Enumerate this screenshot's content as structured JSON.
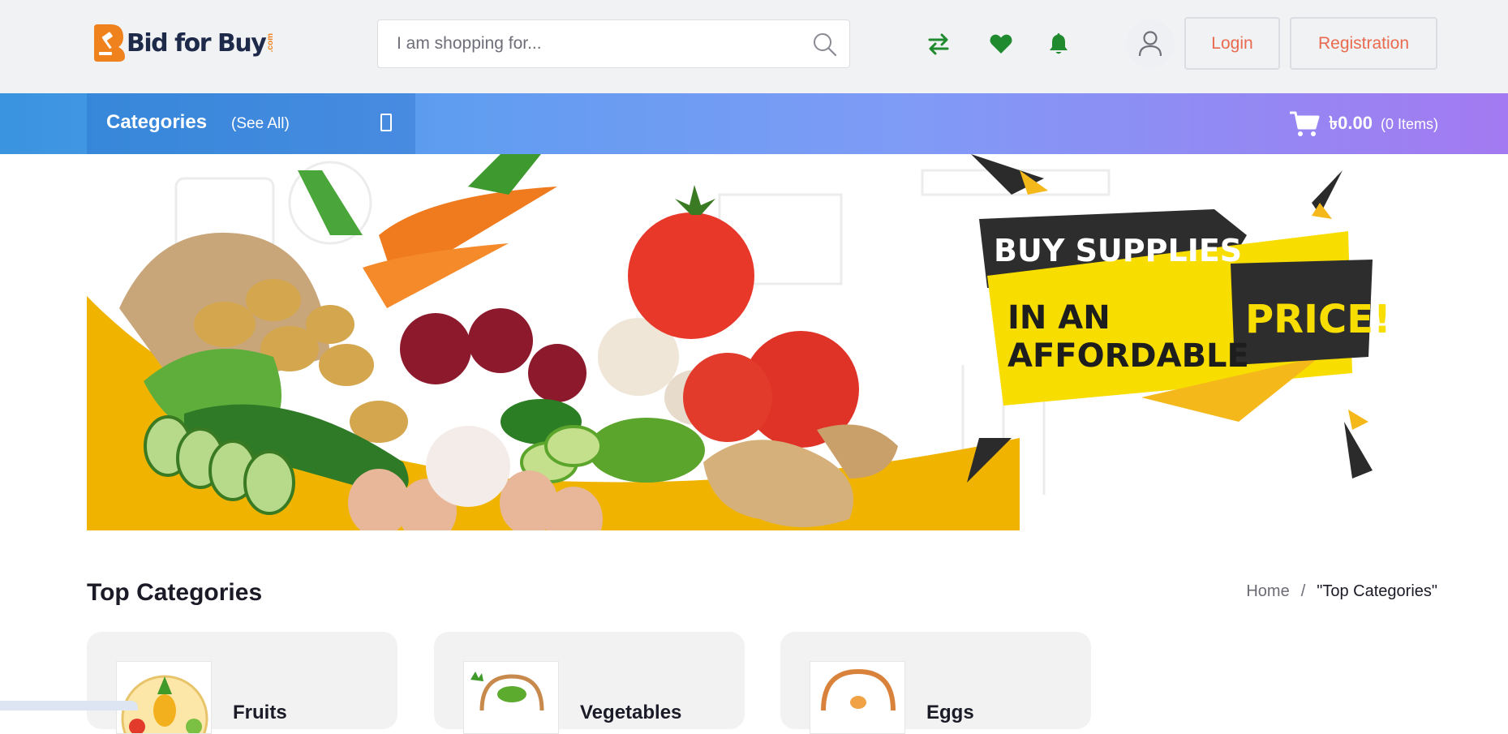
{
  "header": {
    "logo_text": "Bid for Buy",
    "logo_suffix": ".com",
    "search": {
      "placeholder": "I am shopping for..."
    },
    "icons": {
      "compare": "compare-arrows-icon",
      "wishlist": "heart-icon",
      "notifications": "bell-icon",
      "account": "user-icon"
    },
    "login_label": "Login",
    "registration_label": "Registration"
  },
  "nav": {
    "categories_label": "Categories",
    "see_all_label": "(See All)",
    "cart": {
      "amount": "৳0.00",
      "items": "(0 Items)"
    }
  },
  "banner": {
    "line1": "BUY SUPPLIES",
    "line2": "IN AN",
    "line3": "AFFORDABLE",
    "line4": "PRICE!"
  },
  "top_categories": {
    "title": "Top Categories",
    "breadcrumb": {
      "home": "Home",
      "separator": "/",
      "current": "\"Top Categories\""
    },
    "items": [
      {
        "name": "Fruits"
      },
      {
        "name": "Vegetables"
      },
      {
        "name": "Eggs"
      }
    ]
  },
  "colors": {
    "accent_green": "#1f8a2e",
    "button_text": "#e96a4f",
    "banner_yellow": "#f0b400",
    "nav_gradient_start": "#3a94e0",
    "nav_gradient_end": "#a37af1"
  }
}
